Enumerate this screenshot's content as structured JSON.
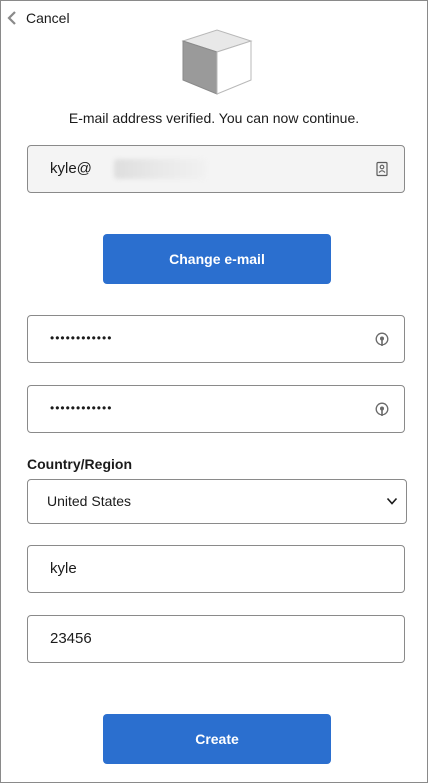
{
  "nav": {
    "back_label": "Cancel"
  },
  "header": {
    "verified_message": "E-mail address verified. You can now continue."
  },
  "email": {
    "value_prefix": "kyle@"
  },
  "buttons": {
    "change_email": "Change e-mail",
    "create": "Create"
  },
  "password": {
    "value": "••••••••••••"
  },
  "confirm_password": {
    "value": "••••••••••••"
  },
  "country": {
    "label": "Country/Region",
    "selected": "United States"
  },
  "name_field": {
    "value": "kyle"
  },
  "zip_field": {
    "value": "23456"
  },
  "colors": {
    "accent": "#2b6fcf",
    "border": "#8a8a8a",
    "readonly_bg": "#f4f4f4"
  },
  "icons": [
    "chevron-left-icon",
    "cube-logo-icon",
    "contact-card-icon",
    "password-key-icon",
    "chevron-down-icon"
  ]
}
